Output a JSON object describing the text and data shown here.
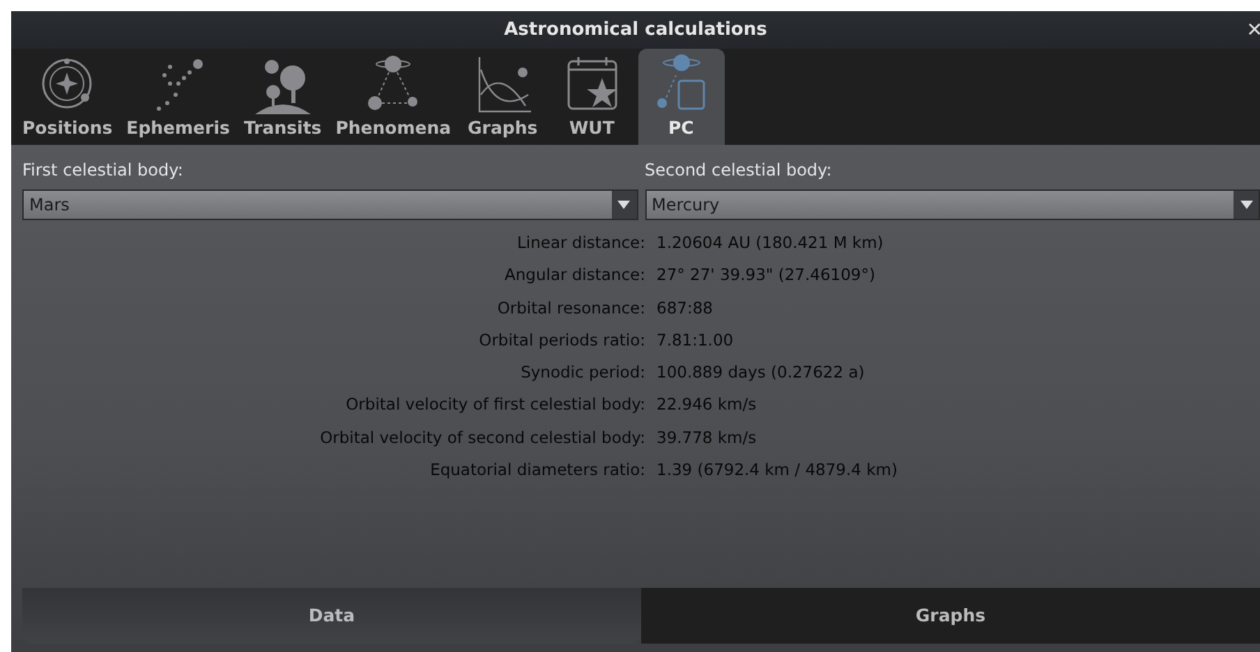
{
  "window": {
    "title": "Astronomical calculations",
    "close": "✕"
  },
  "tabs": [
    {
      "label": "Positions",
      "selected": false
    },
    {
      "label": "Ephemeris",
      "selected": false
    },
    {
      "label": "Transits",
      "selected": false
    },
    {
      "label": "Phenomena",
      "selected": false
    },
    {
      "label": "Graphs",
      "selected": false
    },
    {
      "label": "WUT",
      "selected": false
    },
    {
      "label": "PC",
      "selected": true
    }
  ],
  "first_body": {
    "label": "First celestial body:",
    "value": "Mars"
  },
  "second_body": {
    "label": "Second celestial body:",
    "value": "Mercury"
  },
  "results": [
    {
      "label": "Linear distance:",
      "value": "1.20604 AU (180.421 M km)"
    },
    {
      "label": "Angular distance:",
      "value": "27° 27' 39.93\" (27.46109°)"
    },
    {
      "label": "Orbital resonance:",
      "value": "687:88"
    },
    {
      "label": "Orbital periods ratio:",
      "value": "7.81:1.00"
    },
    {
      "label": "Synodic period:",
      "value": "100.889 days (0.27622 a)"
    },
    {
      "label": "Orbital velocity of first celestial body:",
      "value": "22.946 km/s"
    },
    {
      "label": "Orbital velocity of second celestial body:",
      "value": "39.778 km/s"
    },
    {
      "label": "Equatorial diameters ratio:",
      "value": "1.39 (6792.4 km / 4879.4 km)"
    }
  ],
  "bottom_tabs": [
    {
      "label": "Data",
      "selected": true
    },
    {
      "label": "Graphs",
      "selected": false
    }
  ]
}
